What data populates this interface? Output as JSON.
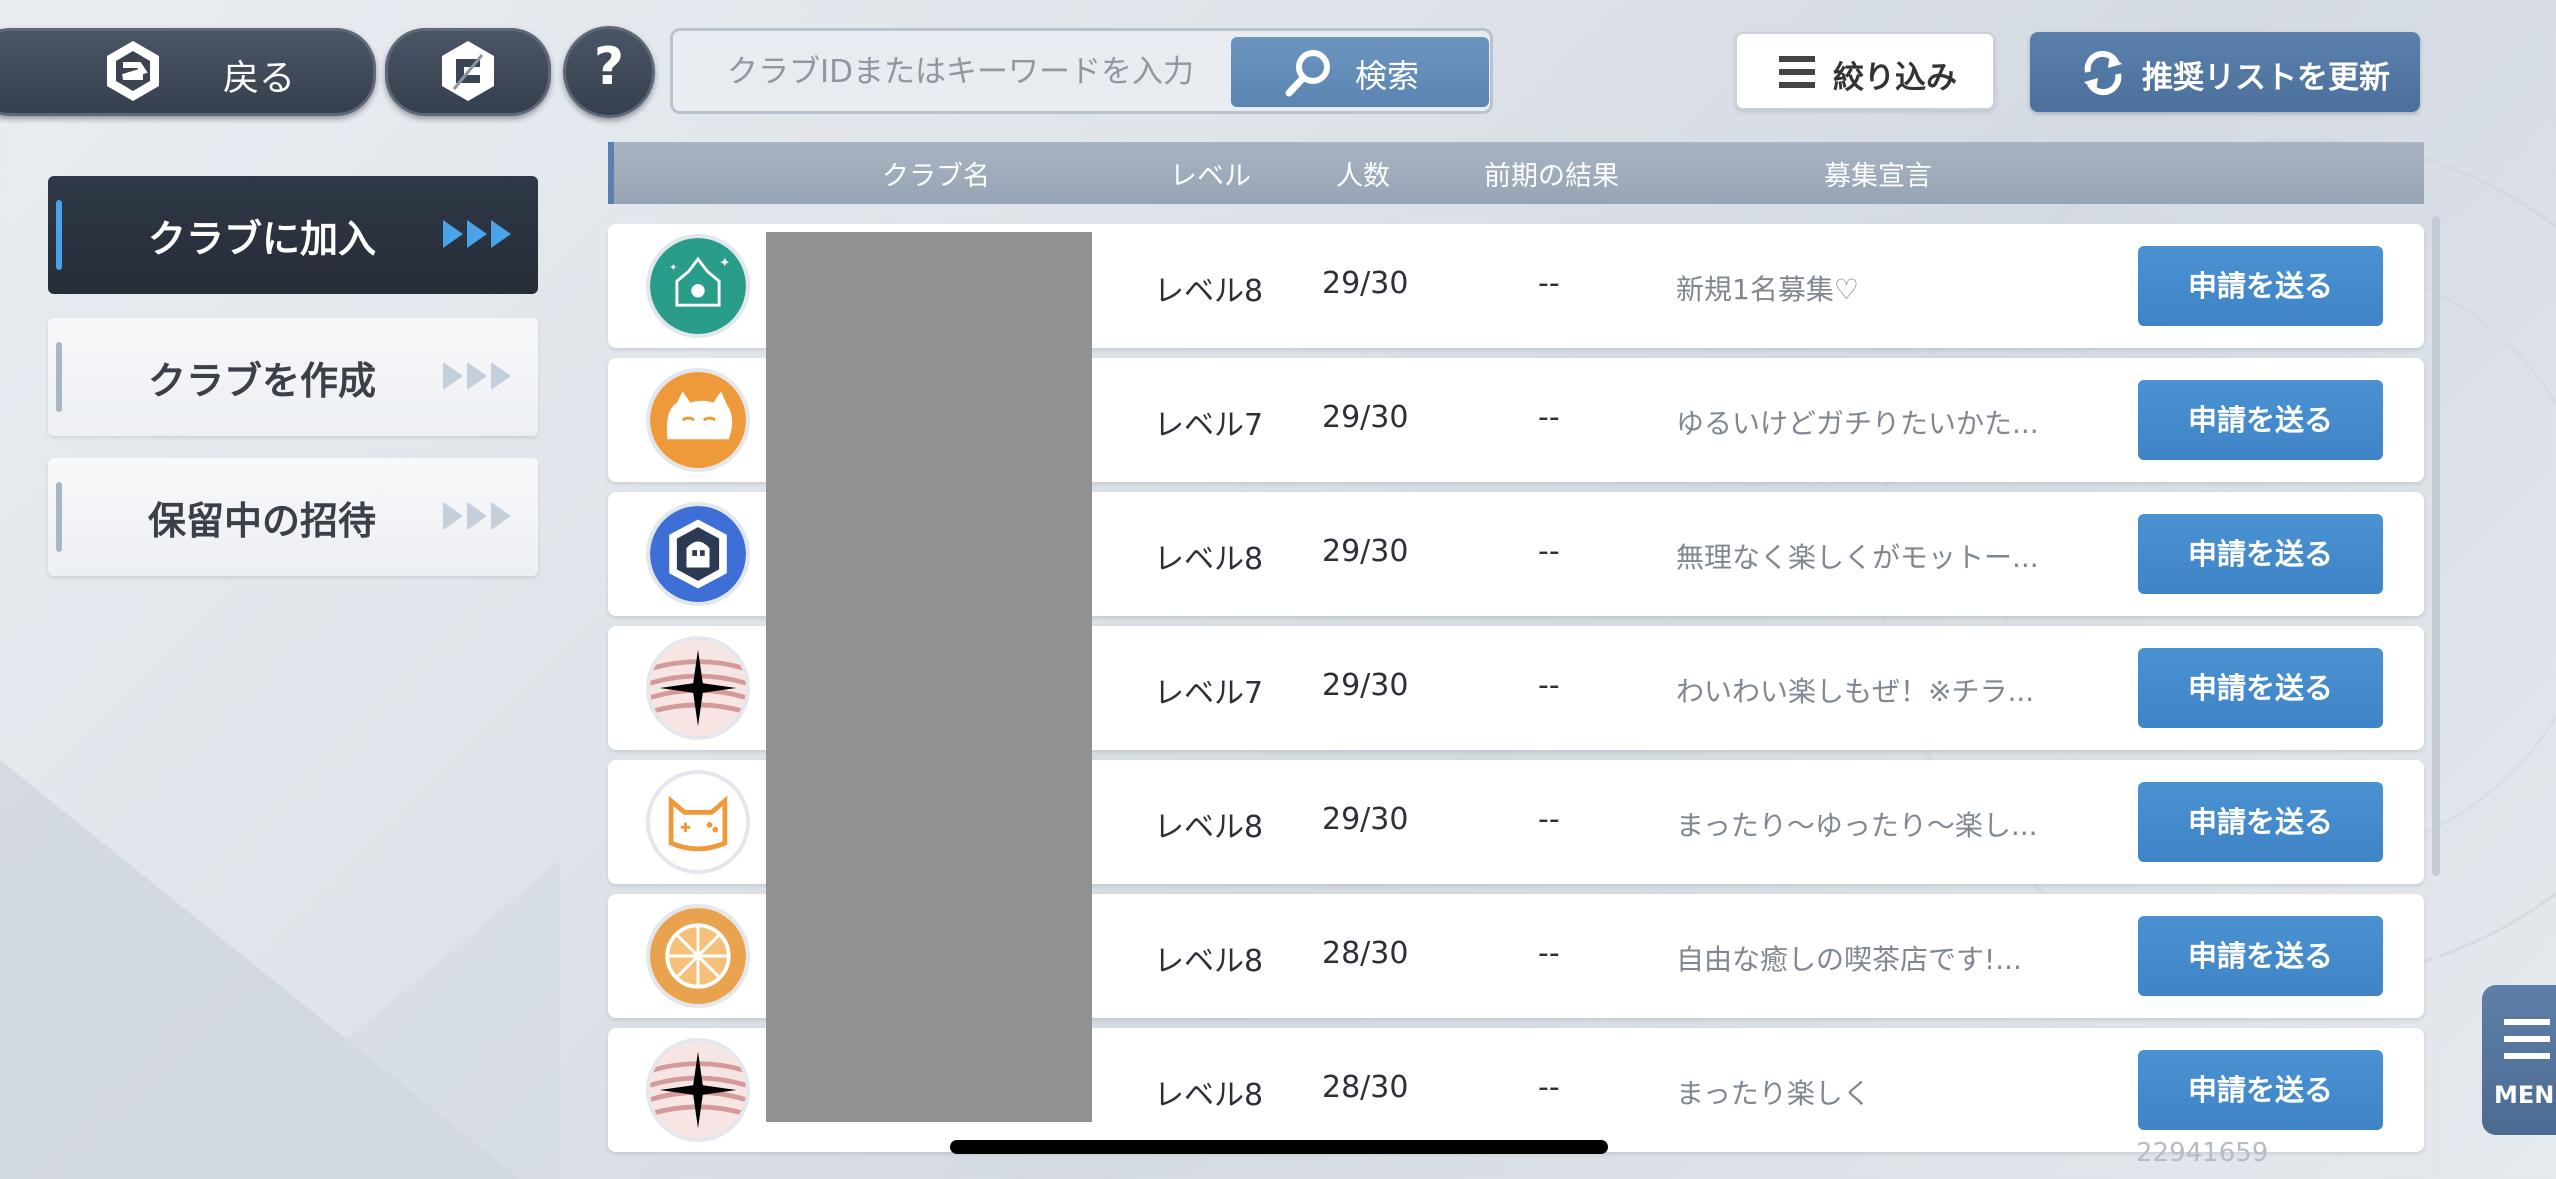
{
  "toolbar": {
    "back_label": "戻る",
    "help_label": "?",
    "search_placeholder": "クラブIDまたはキーワードを入力",
    "search_label": "検索",
    "filter_label": "絞り込み",
    "refresh_label": "推奨リストを更新"
  },
  "sidebar": {
    "items": [
      {
        "label": "クラブに加入",
        "active": true
      },
      {
        "label": "クラブを作成",
        "active": false
      },
      {
        "label": "保留中の招待",
        "active": false
      }
    ]
  },
  "table": {
    "headers": {
      "name": "クラブ名",
      "level": "レベル",
      "members": "人数",
      "result": "前期の結果",
      "message": "募集宣言"
    },
    "rows": [
      {
        "icon": "teal-castle-emblem-icon",
        "level": "レベル8",
        "members": "29/30",
        "result": "--",
        "message": "新規1名募集♡",
        "action": "申請を送る"
      },
      {
        "icon": "orange-cat-icon",
        "level": "レベル7",
        "members": "29/30",
        "result": "--",
        "message": "ゆるいけどガチりたいかた...",
        "action": "申請を送る"
      },
      {
        "icon": "blue-hexagon-ghost-icon",
        "level": "レベル8",
        "members": "29/30",
        "result": "--",
        "message": "無理なく楽しくがモットー...",
        "action": "申請を送る"
      },
      {
        "icon": "black-star-stripes-icon",
        "level": "レベル7",
        "members": "29/30",
        "result": "--",
        "message": "わいわい楽しもぜ！※チラ...",
        "action": "申請を送る"
      },
      {
        "icon": "orange-cat-controller-icon",
        "level": "レベル8",
        "members": "29/30",
        "result": "--",
        "message": "まったり〜ゆったり〜楽し...",
        "action": "申請を送る"
      },
      {
        "icon": "orange-citrus-icon",
        "level": "レベル8",
        "members": "28/30",
        "result": "--",
        "message": "自由な癒しの喫茶店です!...",
        "action": "申請を送る"
      },
      {
        "icon": "black-star-stripes-icon",
        "level": "レベル8",
        "members": "28/30",
        "result": "--",
        "message": "まったり楽しく",
        "action": "申請を送る"
      }
    ]
  },
  "footer": {
    "uid": "22941659",
    "menu_label": "MENU"
  },
  "colors": {
    "accent_blue": "#3f84c6",
    "active_sidebar": "#2f3846",
    "header_bar": "#9aa8b8"
  }
}
